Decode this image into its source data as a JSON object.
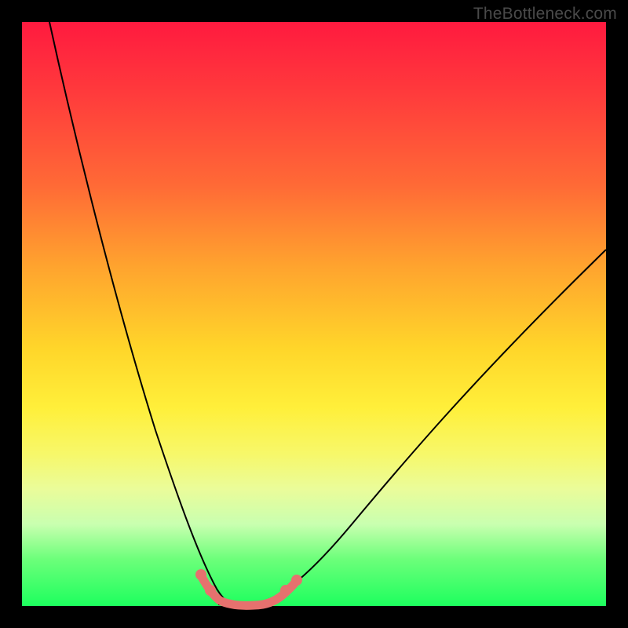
{
  "watermark": {
    "text": "TheBottleneck.com"
  },
  "colors": {
    "frame_bg": "#000000",
    "curve_stroke": "#000000",
    "highlight_stroke": "#e6716e",
    "highlight_dot_fill": "#e6716e"
  },
  "chart_data": {
    "type": "line",
    "title": "",
    "xlabel": "",
    "ylabel": "",
    "xlim": [
      0,
      100
    ],
    "ylim": [
      0,
      100
    ],
    "grid": false,
    "legend_position": "none",
    "series": [
      {
        "name": "left-curve",
        "x": [
          4,
          8,
          12,
          16,
          20,
          23,
          26,
          28,
          30,
          32
        ],
        "values": [
          100,
          76,
          53,
          34,
          19,
          11,
          6,
          3,
          1,
          0
        ]
      },
      {
        "name": "valley",
        "x": [
          32,
          34,
          36,
          38,
          40
        ],
        "values": [
          0,
          0,
          0,
          0,
          0
        ]
      },
      {
        "name": "right-curve",
        "x": [
          40,
          44,
          50,
          56,
          64,
          74,
          86,
          100
        ],
        "values": [
          0,
          3,
          8,
          14,
          23,
          34,
          47,
          61
        ]
      },
      {
        "name": "highlight-segment",
        "x": [
          29,
          31,
          33,
          35,
          37,
          39,
          41,
          43,
          45
        ],
        "values": [
          4,
          1,
          0,
          0,
          0,
          0,
          1,
          3,
          4
        ]
      }
    ]
  }
}
